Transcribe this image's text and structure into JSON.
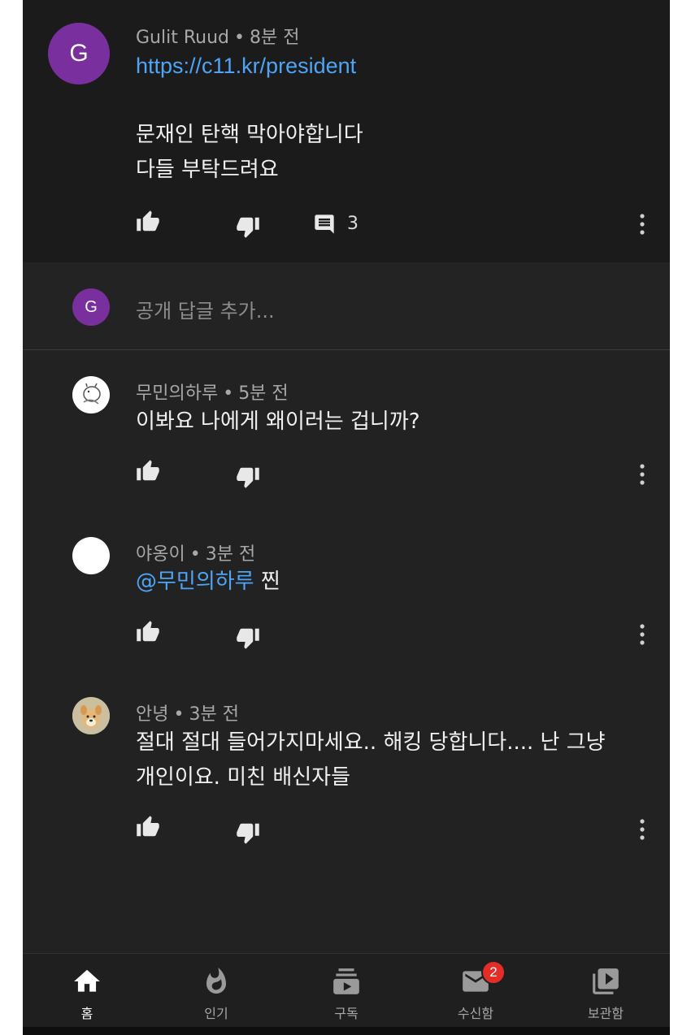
{
  "parent_comment": {
    "avatar_letter": "G",
    "author": "Gulit Ruud",
    "time": "8분 전",
    "link": "https://c11.kr/president",
    "text_line1": "문재인 탄핵 막아야합니다",
    "text_line2": "다들 부탁드려요",
    "reply_count": "3"
  },
  "reply_box": {
    "avatar_letter": "G",
    "placeholder": "공개 답글 추가..."
  },
  "replies": [
    {
      "author": "무민의하루",
      "time": "5분 전",
      "text": "이봐요 나에게 왜이러는 겁니까?"
    },
    {
      "author": "야옹이",
      "time": "3분 전",
      "mention": "@무민의하루",
      "text": " 찐"
    },
    {
      "author": "안녕",
      "time": "3분 전",
      "text_line1": "절대 절대 들어가지마세요.. 해킹 당합니다.... 난 그냥",
      "text_line2": "개인이요.  미친 배신자들"
    }
  ],
  "meta_separator": "•",
  "bottom_nav": {
    "items": [
      {
        "label": "홈",
        "icon": "home-icon",
        "active": true
      },
      {
        "label": "인기",
        "icon": "explore-fire-icon"
      },
      {
        "label": "구독",
        "icon": "subscriptions-icon"
      },
      {
        "label": "수신함",
        "icon": "inbox-mail-icon",
        "badge": "2"
      },
      {
        "label": "보관함",
        "icon": "library-icon"
      }
    ]
  },
  "colors": {
    "background": "#222222",
    "parent_background": "#1b1b1b",
    "link": "#4ea5f5",
    "avatar_purple": "#7a2f9f",
    "badge_red": "#e52d27"
  }
}
